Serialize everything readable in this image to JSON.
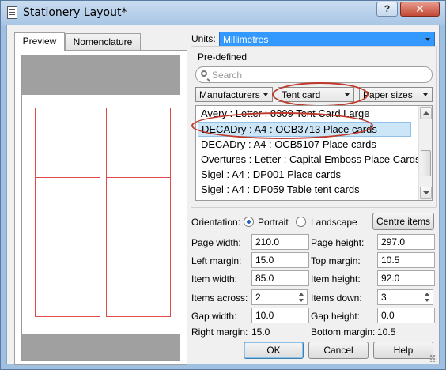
{
  "window": {
    "title": "Stationery Layout*",
    "help_label": "?",
    "close_label": "✕"
  },
  "tabs": [
    {
      "label": "Preview",
      "selected": true
    },
    {
      "label": "Nomenclature",
      "selected": false
    }
  ],
  "units": {
    "label": "Units:",
    "value": "Millimetres"
  },
  "predefined": {
    "label": "Pre-defined",
    "search_placeholder": "Search",
    "filters": {
      "manufacturers": "Manufacturers",
      "tent_card": "Tent card",
      "paper_sizes": "Paper sizes"
    },
    "items": [
      {
        "text": "Avery : Letter : 8309 Tent Card Large",
        "selected": false
      },
      {
        "text": "DECADry : A4 : OCB3713 Place cards",
        "selected": true
      },
      {
        "text": "DECADry : A4 : OCB5107 Place cards",
        "selected": false
      },
      {
        "text": "Overtures : Letter : Capital Emboss Place Cards",
        "selected": false
      },
      {
        "text": "Sigel : A4 : DP001 Place cards",
        "selected": false
      },
      {
        "text": "Sigel : A4 : DP059 Table tent cards",
        "selected": false
      }
    ]
  },
  "orientation": {
    "label": "Orientation:",
    "portrait": "Portrait",
    "landscape": "Landscape",
    "selected": "Portrait"
  },
  "buttons": {
    "centre_items": "Centre items",
    "ok": "OK",
    "cancel": "Cancel",
    "help": "Help"
  },
  "fields": {
    "page_width": {
      "label": "Page width:",
      "value": "210.0"
    },
    "page_height": {
      "label": "Page height:",
      "value": "297.0"
    },
    "left_margin": {
      "label": "Left margin:",
      "value": "15.0"
    },
    "top_margin": {
      "label": "Top margin:",
      "value": "10.5"
    },
    "item_width": {
      "label": "Item width:",
      "value": "85.0"
    },
    "item_height": {
      "label": "Item height:",
      "value": "92.0"
    },
    "items_across": {
      "label": "Items across:",
      "value": "2"
    },
    "items_down": {
      "label": "Items down:",
      "value": "3"
    },
    "gap_width": {
      "label": "Gap width:",
      "value": "10.0"
    },
    "gap_height": {
      "label": "Gap height:",
      "value": "0.0"
    },
    "right_margin": {
      "label": "Right margin:",
      "value": "15.0"
    },
    "bottom_margin": {
      "label": "Bottom margin:",
      "value": "10.5"
    }
  },
  "colors": {
    "selection": "#3399ff",
    "card_outline": "#e14a4a",
    "annotation_circle": "#c0392b"
  }
}
